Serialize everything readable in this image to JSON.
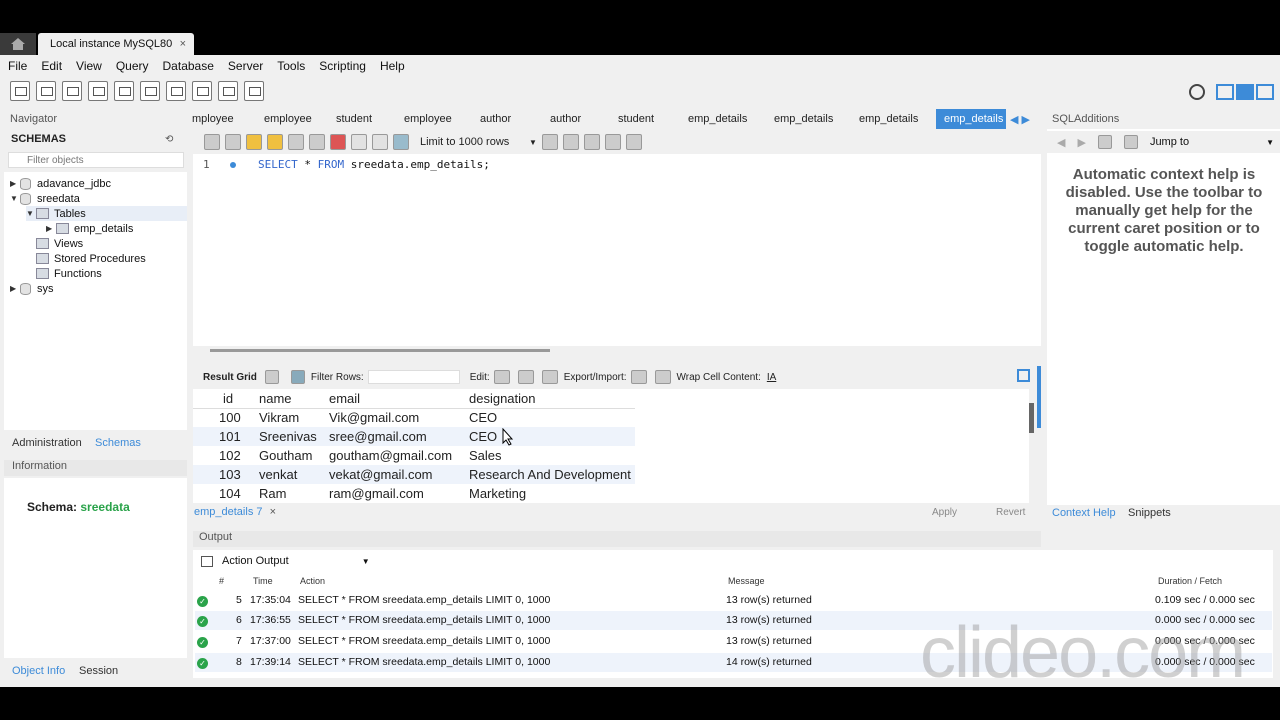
{
  "window": {
    "instance_tab": "Local instance MySQL80",
    "close_glyph": "×"
  },
  "menu": [
    "File",
    "Edit",
    "View",
    "Query",
    "Database",
    "Server",
    "Tools",
    "Scripting",
    "Help"
  ],
  "navigator": {
    "title": "Navigator",
    "schemas_label": "SCHEMAS",
    "filter_placeholder": "Filter objects",
    "tree": [
      {
        "label": "adavance_jdbc"
      },
      {
        "label": "sreedata"
      },
      {
        "label": "Tables"
      },
      {
        "label": "emp_details"
      },
      {
        "label": "Views"
      },
      {
        "label": "Stored Procedures"
      },
      {
        "label": "Functions"
      },
      {
        "label": "sys"
      }
    ],
    "bottom_tabs": [
      "Administration",
      "Schemas"
    ],
    "information_label": "Information",
    "schema_label": "Schema:",
    "schema_value": "sreedata",
    "object_tabs": [
      "Object Info",
      "Session"
    ]
  },
  "sql_tabs": [
    "mployee",
    "employee",
    "student",
    "employee",
    "author",
    "author",
    "student",
    "emp_details",
    "emp_details",
    "emp_details",
    "emp_details"
  ],
  "query_toolbar": {
    "limit_label": "Limit to 1000 rows"
  },
  "editor": {
    "line_number": "1",
    "code_keyword1": "SELECT",
    "code_mid": " * ",
    "code_keyword2": "FROM",
    "code_rest": " sreedata.emp_details;"
  },
  "result_toolbar": {
    "result_grid": "Result Grid",
    "filter_rows": "Filter Rows:",
    "edit": "Edit:",
    "export_import": "Export/Import:",
    "wrap": "Wrap Cell Content:"
  },
  "grid": {
    "columns": [
      "id",
      "name",
      "email",
      "designation"
    ],
    "rows": [
      [
        "100",
        "Vikram",
        "Vik@gmail.com",
        "CEO"
      ],
      [
        "101",
        "Sreenivas",
        "sree@gmail.com",
        "CEO"
      ],
      [
        "102",
        "Goutham",
        "goutham@gmail.com",
        "Sales"
      ],
      [
        "103",
        "venkat",
        "vekat@gmail.com",
        "Research And Development"
      ],
      [
        "104",
        "Ram",
        "ram@gmail.com",
        "Marketing"
      ]
    ]
  },
  "result_tab": "emp_details 7",
  "buttons": {
    "apply": "Apply",
    "revert": "Revert"
  },
  "output": {
    "title": "Output",
    "selector": "Action Output",
    "headers": {
      "num": "#",
      "time": "Time",
      "action": "Action",
      "message": "Message",
      "duration": "Duration / Fetch"
    },
    "rows": [
      {
        "num": "5",
        "time": "17:35:04",
        "action": "SELECT * FROM sreedata.emp_details LIMIT 0, 1000",
        "message": "13 row(s) returned",
        "duration": "0.109 sec / 0.000 sec"
      },
      {
        "num": "6",
        "time": "17:36:55",
        "action": "SELECT * FROM sreedata.emp_details LIMIT 0, 1000",
        "message": "13 row(s) returned",
        "duration": "0.000 sec / 0.000 sec"
      },
      {
        "num": "7",
        "time": "17:37:00",
        "action": "SELECT * FROM sreedata.emp_details LIMIT 0, 1000",
        "message": "13 row(s) returned",
        "duration": "0.000 sec / 0.000 sec"
      },
      {
        "num": "8",
        "time": "17:39:14",
        "action": "SELECT * FROM sreedata.emp_details LIMIT 0, 1000",
        "message": "14 row(s) returned",
        "duration": "0.000 sec / 0.000 sec"
      }
    ]
  },
  "sql_additions": {
    "title": "SQLAdditions",
    "jump_to": "Jump to",
    "help_text": "Automatic context help is disabled. Use the toolbar to manually get help for the current caret position or to toggle automatic help.",
    "tabs": [
      "Context Help",
      "Snippets"
    ]
  },
  "watermark": "clideo.com",
  "colors": {
    "accent": "#3d8bd8",
    "success": "#2aa34a",
    "schema_value": "#2aa34a"
  }
}
